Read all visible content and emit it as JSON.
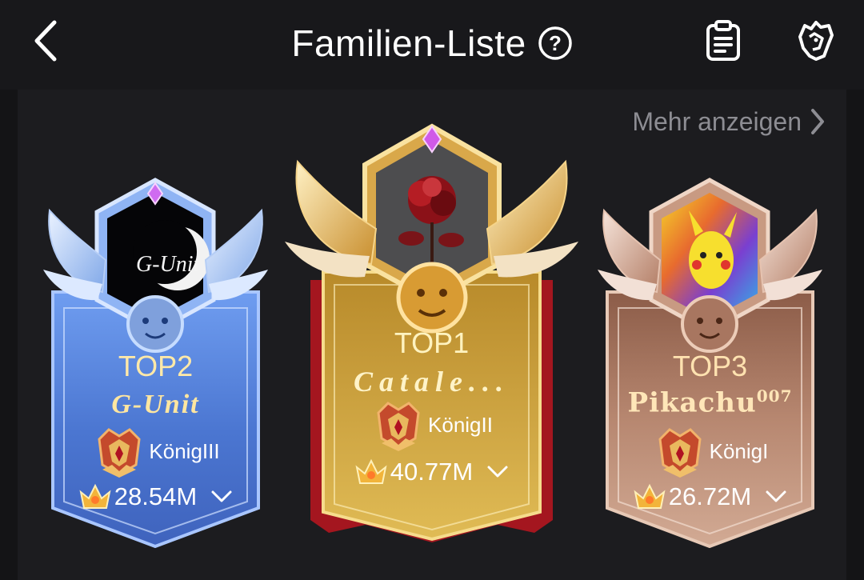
{
  "header": {
    "title": "Familien-Liste",
    "help_symbol": "?",
    "icons": [
      "back-arrow-icon",
      "help-circle-icon",
      "clipboard-icon",
      "lion-head-icon"
    ]
  },
  "more_link": {
    "label": "Mehr anzeigen",
    "icon": "chevron-right-icon"
  },
  "ranking": [
    {
      "rank_label": "TOP2",
      "family_name": "G-Unit",
      "emblem_text": "G-Unit",
      "level": "KönigIII",
      "score": "28.54M",
      "theme": "silver-blue",
      "accent": "#5b84d8"
    },
    {
      "rank_label": "TOP1",
      "family_name": "Catale...",
      "level": "KönigII",
      "score": "40.77M",
      "theme": "gold",
      "accent": "#c9962f"
    },
    {
      "rank_label": "TOP3",
      "family_name": "Pikachu",
      "name_suffix": "007",
      "level": "KönigI",
      "score": "26.72M",
      "theme": "bronze",
      "accent": "#b98a72"
    }
  ],
  "colors": {
    "background": "#141416",
    "panel": "#1c1c1f",
    "rank_text_top1": "#fff3c0",
    "rank_text_top2": "#ffe9a8",
    "rank_text_top3": "#ffe2b0",
    "link_grey": "#8d8d93"
  }
}
